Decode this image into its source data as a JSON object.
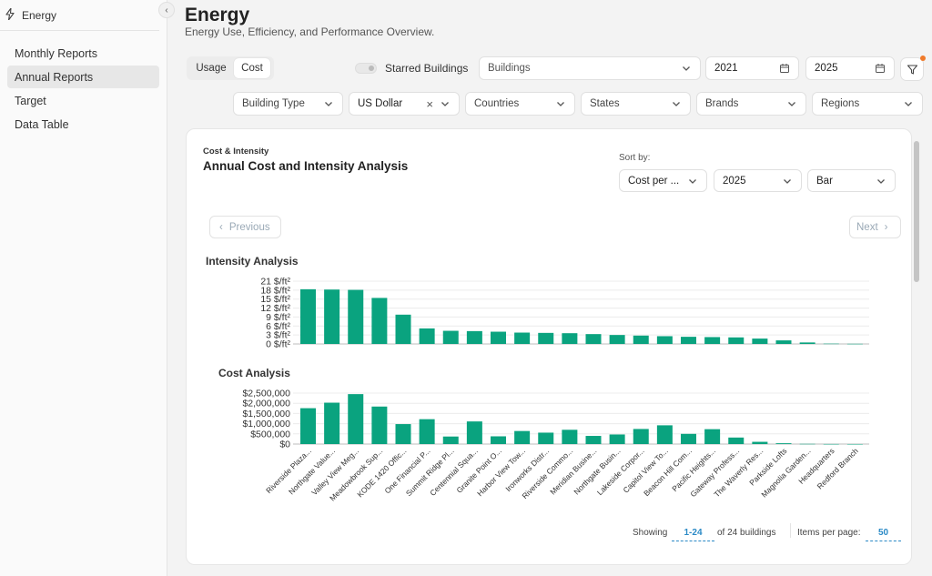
{
  "app": {
    "section": "Energy"
  },
  "sidebar": {
    "items": [
      {
        "label": "Monthly Reports",
        "active": false
      },
      {
        "label": "Annual Reports",
        "active": true
      },
      {
        "label": "Target",
        "active": false
      },
      {
        "label": "Data Table",
        "active": false
      }
    ]
  },
  "header": {
    "title": "Energy",
    "subtitle": "Energy Use, Efficiency, and Performance Overview."
  },
  "toolbar": {
    "usage_label": "Usage",
    "cost_label": "Cost",
    "selected_mode": "Cost",
    "starred_label": "Starred Buildings",
    "buildings_placeholder": "Buildings",
    "start_year": "2021",
    "end_year": "2025"
  },
  "filters": {
    "building_type": "Building Type",
    "currency": "US Dollar",
    "countries": "Countries",
    "states": "States",
    "brands": "Brands",
    "regions": "Regions"
  },
  "card": {
    "kicker": "Cost & Intensity",
    "title": "Annual Cost and Intensity Analysis",
    "sort_by_label": "Sort by:",
    "sort_value": "Cost per ...",
    "year_value": "2025",
    "chart_type_value": "Bar",
    "previous_label": "Previous",
    "next_label": "Next"
  },
  "footer": {
    "showing_label": "Showing",
    "range": "1-24",
    "total_text": "of 24 buildings",
    "items_per_page_label": "Items per page:",
    "items_per_page": "50"
  },
  "colors": {
    "bar": "#0aa37f",
    "accent_dot": "#f07a2a",
    "link": "#2b8ac6"
  },
  "chart_data": [
    {
      "type": "bar",
      "title": "Intensity Analysis",
      "categories": [
        "Riverside Plaza...",
        "Northgate Value...",
        "Valley View Meg...",
        "Meadowbrook Sup...",
        "KODE 1420 Offic...",
        "One Financial P...",
        "Summit Ridge Pl...",
        "Centennial Squa...",
        "Granite Point O...",
        "Harbor View Tow...",
        "Ironworks Distr...",
        "Riverside Commo...",
        "Meridian Busine...",
        "Northgate Busin...",
        "Lakeside Corpor...",
        "Capitol View To...",
        "Beacon Hill Com...",
        "Pacific Heights...",
        "Gateway Profess...",
        "The Waverly Res...",
        "Parkside Lofts",
        "Magnolia Garden...",
        "Headquarters",
        "Redford Branch"
      ],
      "values": [
        18.3,
        18.2,
        18.1,
        15.4,
        9.8,
        5.2,
        4.4,
        4.3,
        4.1,
        3.8,
        3.7,
        3.6,
        3.3,
        3.0,
        2.8,
        2.6,
        2.4,
        2.3,
        2.2,
        1.8,
        1.2,
        0.5,
        0.1,
        0.05
      ],
      "ylim": [
        0,
        21
      ],
      "yticks": [
        "0 $/ft²",
        "3 $/ft²",
        "6 $/ft²",
        "9 $/ft²",
        "12 $/ft²",
        "15 $/ft²",
        "18 $/ft²",
        "21 $/ft²"
      ],
      "grid": true
    },
    {
      "type": "bar",
      "title": "Cost Analysis",
      "categories": [
        "Riverside Plaza...",
        "Northgate Value...",
        "Valley View Meg...",
        "Meadowbrook Sup...",
        "KODE 1420 Offic...",
        "One Financial P...",
        "Summit Ridge Pl...",
        "Centennial Squa...",
        "Granite Point O...",
        "Harbor View Tow...",
        "Ironworks Distr...",
        "Riverside Commo...",
        "Meridian Busine...",
        "Northgate Busin...",
        "Lakeside Corpor...",
        "Capitol View To...",
        "Beacon Hill Com...",
        "Pacific Heights...",
        "Gateway Profess...",
        "The Waverly Res...",
        "Parkside Lofts",
        "Magnolia Garden...",
        "Headquarters",
        "Redford Branch"
      ],
      "values": [
        1760000,
        2030000,
        2450000,
        1840000,
        980000,
        1220000,
        370000,
        1110000,
        380000,
        640000,
        560000,
        700000,
        400000,
        470000,
        740000,
        920000,
        500000,
        730000,
        320000,
        110000,
        40000,
        10000,
        3000,
        1000
      ],
      "ylim": [
        0,
        2500000
      ],
      "yticks": [
        "$0",
        "$500,000",
        "$1,000,000",
        "$1,500,000",
        "$2,000,000",
        "$2,500,000"
      ],
      "grid": true
    }
  ]
}
